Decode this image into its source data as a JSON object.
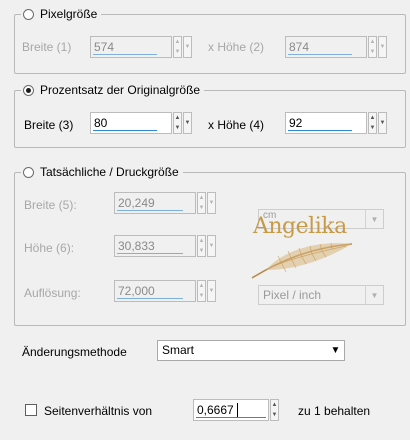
{
  "pixel_group": {
    "legend": "Pixelgröße",
    "width_label": "Breite (1)",
    "width_value": "574",
    "height_label": "x Höhe (2)",
    "height_value": "874"
  },
  "percent_group": {
    "legend": "Prozentsatz der Originalgröße",
    "width_label": "Breite (3)",
    "width_value": "80",
    "height_label": "x Höhe (4)",
    "height_value": "92"
  },
  "print_group": {
    "legend": "Tatsächliche / Druckgröße",
    "width_label": "Breite (5):",
    "width_value": "20,249",
    "height_label": "Höhe (6):",
    "height_value": "30,833",
    "resolution_label": "Auflösung:",
    "resolution_value": "72,000",
    "unit_value": "cm",
    "res_unit_value": "Pixel / inch"
  },
  "watermark": "Angelika",
  "method": {
    "label": "Änderungsmethode",
    "value": "Smart"
  },
  "aspect": {
    "label": "Seitenverhältnis von",
    "value": "0,6667",
    "suffix": "zu 1 behalten"
  }
}
